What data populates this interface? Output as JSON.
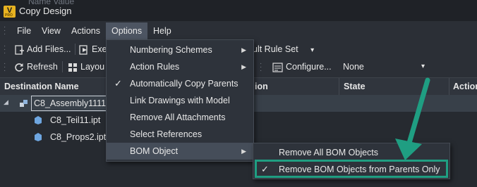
{
  "window": {
    "title": "Copy Design",
    "title_ghost": "Name Value"
  },
  "menubar": {
    "items": [
      "File",
      "View",
      "Actions",
      "Options",
      "Help"
    ],
    "active": "Options"
  },
  "toolbar1": {
    "add_files": "Add Files...",
    "exe_partial": "Exe",
    "rule_set_partial": "ult Rule Set"
  },
  "toolbar2": {
    "refresh": "Refresh",
    "layout_partial": "Layou",
    "configure": "Configure...",
    "none_select": "None"
  },
  "grid": {
    "columns": {
      "destination": "Destination Name",
      "ion_partial": "ion",
      "state": "State",
      "action_partial": "Action"
    },
    "rows": [
      {
        "name": "C8_Assembly1111.i",
        "level": 0
      },
      {
        "name": "C8_Teil11.ipt",
        "level": 1
      },
      {
        "name": "C8_Props2.ipt",
        "level": 1
      }
    ]
  },
  "options_menu": {
    "items": [
      {
        "label": "Numbering Schemes",
        "submenu": true,
        "checked": false
      },
      {
        "label": "Action Rules",
        "submenu": true,
        "checked": false
      },
      {
        "label": "Automatically Copy Parents",
        "submenu": false,
        "checked": true
      },
      {
        "label": "Link Drawings with Model",
        "submenu": false,
        "checked": false
      },
      {
        "label": "Remove All Attachments",
        "submenu": false,
        "checked": false
      },
      {
        "label": "Select References",
        "submenu": false,
        "checked": false
      },
      {
        "label": "BOM Object",
        "submenu": true,
        "checked": false
      }
    ]
  },
  "bom_submenu": {
    "items": [
      {
        "label": "Remove All BOM Objects",
        "checked": false
      },
      {
        "label": "Remove BOM Objects from Parents Only",
        "checked": true
      }
    ]
  },
  "colors": {
    "annotation": "#1f9e82",
    "app_icon": "#e8b321"
  },
  "glyphs": {
    "check": "✓",
    "arrow_right": "▶",
    "caret_down": "▾",
    "tree_expand": "◢"
  }
}
